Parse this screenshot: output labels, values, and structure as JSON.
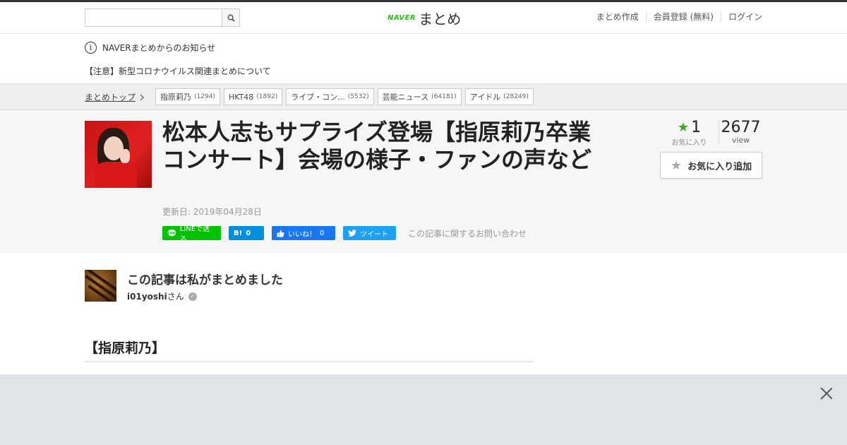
{
  "header": {
    "search": {
      "value": "",
      "placeholder": ""
    },
    "logo_brand": "NAVER",
    "logo_text": "まとめ",
    "links": [
      "まとめ作成",
      "会員登録 (無料)",
      "ログイン"
    ]
  },
  "notice": {
    "info_text": "NAVERまとめからのお知らせ",
    "link_text": "【注意】新型コロナウイルス関連まとめについて"
  },
  "breadcrumb": {
    "top": "まとめトップ",
    "tags": [
      {
        "label": "指原莉乃",
        "count": "(1294)"
      },
      {
        "label": "HKT48",
        "count": "(1892)"
      },
      {
        "label": "ライブ・コン...",
        "count": "(5532)"
      },
      {
        "label": "芸能ニュース",
        "count": "(64181)"
      },
      {
        "label": "アイドル",
        "count": "(28249)"
      }
    ]
  },
  "article": {
    "title": "松本人志もサプライズ登場【指原莉乃卒業コンサート】会場の様子・ファンの声など",
    "updated": "更新日: 2019年04月28日",
    "share": {
      "line": "LINEで送る",
      "hatena_mark": "B!",
      "hatena_count": "0",
      "facebook": "いいね！",
      "facebook_count": "0",
      "tweet": "ツイート"
    },
    "inquiry": "この記事に関するお問い合わせ"
  },
  "stats": {
    "favorites": "1",
    "favorites_label": "お気に入り",
    "views": "2677",
    "views_label": "view",
    "fav_button": "お気に入り追加"
  },
  "author": {
    "heading": "この記事は私がまとめました",
    "name": "i01yoshi",
    "suffix": "さん"
  },
  "section": {
    "heading": "【指原莉乃】"
  },
  "colors": {
    "naver_green": "#1ec800",
    "line_green": "#00c300",
    "hatena_blue": "#008fde",
    "facebook_blue": "#1877f2",
    "twitter_blue": "#1da1f2",
    "star_green": "#3aa520"
  }
}
